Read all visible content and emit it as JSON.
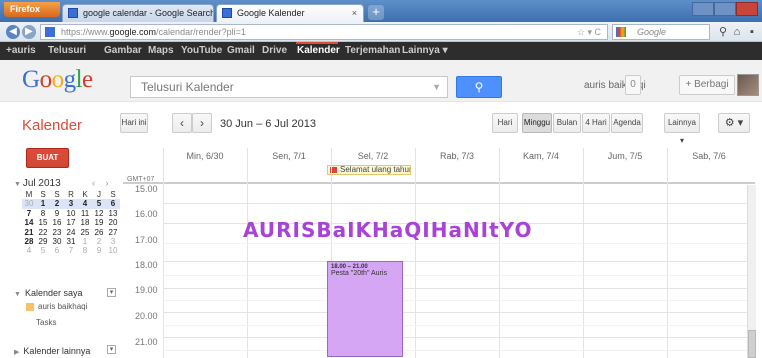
{
  "browser": {
    "app_button": "Firefox",
    "tabs": [
      {
        "label": "google calendar - Google Search"
      },
      {
        "label": "Google Kalender"
      }
    ],
    "new_tab": "+",
    "url_prefix": "https://www.",
    "url_domain": "google.com",
    "url_path": "/calendar/render?pli=1",
    "search_engine": "Google"
  },
  "gbar": {
    "items": [
      "+auris",
      "Telusuri",
      "Gambar",
      "Maps",
      "YouTube",
      "Gmail",
      "Drive",
      "Kalender",
      "Terjemahan",
      "Lainnya ▾"
    ],
    "selected": "Kalender"
  },
  "header": {
    "logo": "Google",
    "search_placeholder": "Telusuri Kalender",
    "user_name": "auris baikhaqi",
    "notifications": "0",
    "share_label": "+ Berbagi"
  },
  "toolbar": {
    "title": "Kalender",
    "today": "Hari ini",
    "prev": "‹",
    "next": "›",
    "date_range": "30 Jun – 6 Jul 2013",
    "views": [
      "Hari",
      "Minggu",
      "Bulan",
      "4 Hari",
      "Agenda"
    ],
    "selected_view": "Minggu",
    "more": "Lainnya ▾",
    "settings": "⚙ ▾"
  },
  "sidebar": {
    "create": "BUAT",
    "mini_month": "Jul 2013",
    "mini_arrows": "‹ ›",
    "weekday_headers": [
      "M",
      "S",
      "S",
      "R",
      "K",
      "J",
      "S"
    ],
    "weeks": [
      [
        "30",
        "1",
        "2",
        "3",
        "4",
        "5",
        "6"
      ],
      [
        "7",
        "8",
        "9",
        "10",
        "11",
        "12",
        "13"
      ],
      [
        "14",
        "15",
        "16",
        "17",
        "18",
        "19",
        "20"
      ],
      [
        "21",
        "22",
        "23",
        "24",
        "25",
        "26",
        "27"
      ],
      [
        "28",
        "29",
        "30",
        "31",
        "1",
        "2",
        "3"
      ],
      [
        "4",
        "5",
        "6",
        "7",
        "8",
        "9",
        "10"
      ]
    ],
    "my_calendars": "Kalender saya",
    "calendars": [
      {
        "name": "auris baikhaqi",
        "color": "#f3c26b"
      },
      {
        "name": "Tasks",
        "color": ""
      }
    ],
    "other_calendars": "Kalender lainnya"
  },
  "week": {
    "timezone": "GMT+07",
    "days": [
      "Min, 6/30",
      "Sen, 7/1",
      "Sel, 7/2",
      "Rab, 7/3",
      "Kam, 7/4",
      "Jum, 7/5",
      "Sab, 7/6"
    ],
    "hours": [
      "15.00",
      "16.00",
      "17.00",
      "18.00",
      "19.00",
      "20.00",
      "21.00"
    ],
    "allday_event": "Selamat ulang tahun",
    "event": {
      "time": "18.00 – 21.00",
      "title": "Pesta \"20th\" Auris",
      "color": "#d5a6f3"
    }
  },
  "watermark": "AURISBaIKHaQIHaNItYO"
}
